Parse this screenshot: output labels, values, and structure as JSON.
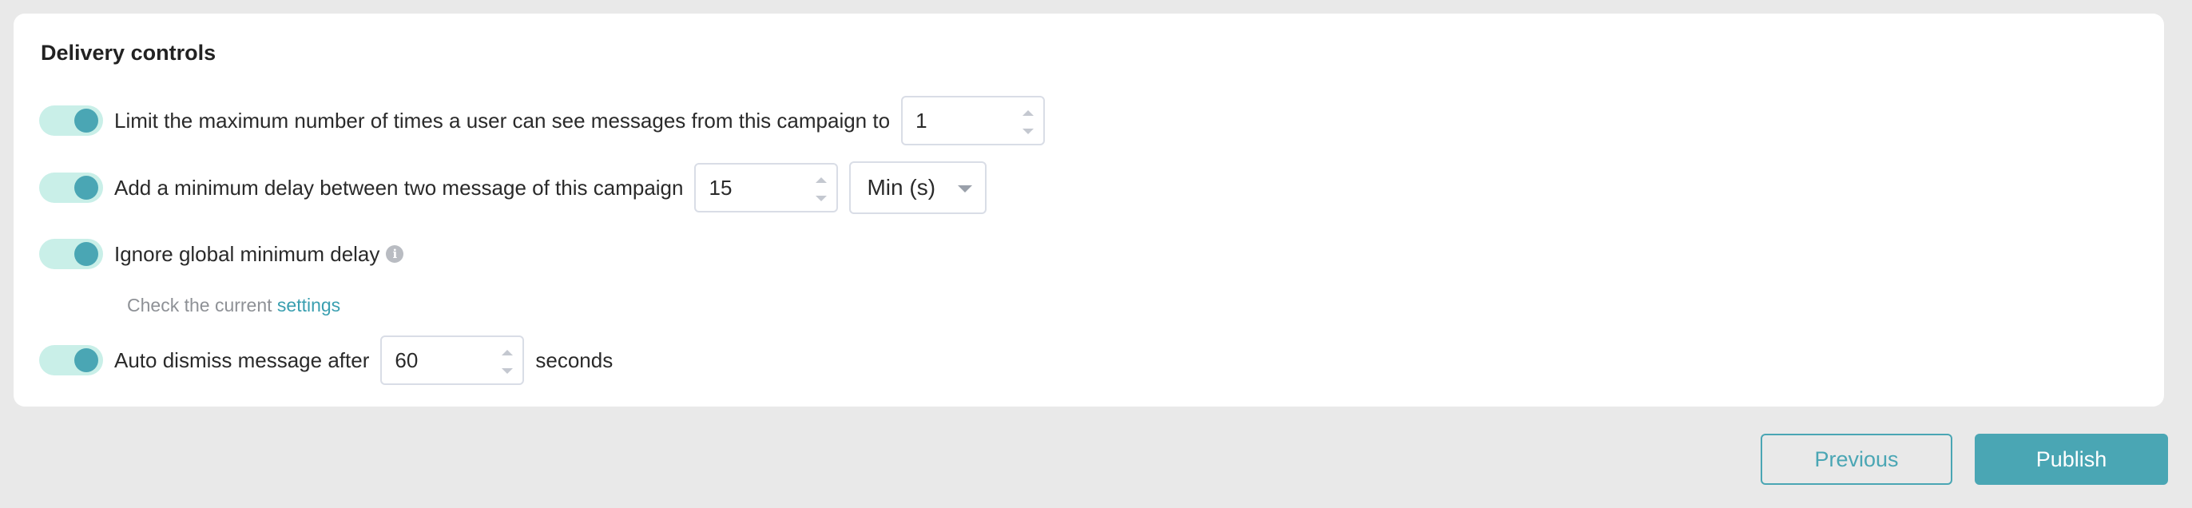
{
  "delivery_controls": {
    "title": "Delivery controls",
    "rows": [
      {
        "label": "Limit the maximum number of times a user can see messages from this campaign to",
        "value": "1",
        "enabled": true
      },
      {
        "label": "Add a minimum delay between two message of this campaign",
        "value": "15",
        "unit": "Min (s)",
        "enabled": true
      },
      {
        "label": "Ignore global minimum delay",
        "enabled": true,
        "hint_text": "Check the current",
        "hint_link": "settings"
      },
      {
        "label": "Auto dismiss message after",
        "value": "60",
        "suffix": "seconds",
        "enabled": true
      }
    ]
  },
  "footer": {
    "previous_label": "Previous",
    "publish_label": "Publish"
  },
  "colors": {
    "accent": "#4aa6b4",
    "toggle_track": "#c9efe8",
    "page_bg": "#e9e9e9"
  },
  "icons": [
    "info-icon",
    "spinner-up-icon",
    "spinner-down-icon",
    "chevron-down-icon"
  ]
}
